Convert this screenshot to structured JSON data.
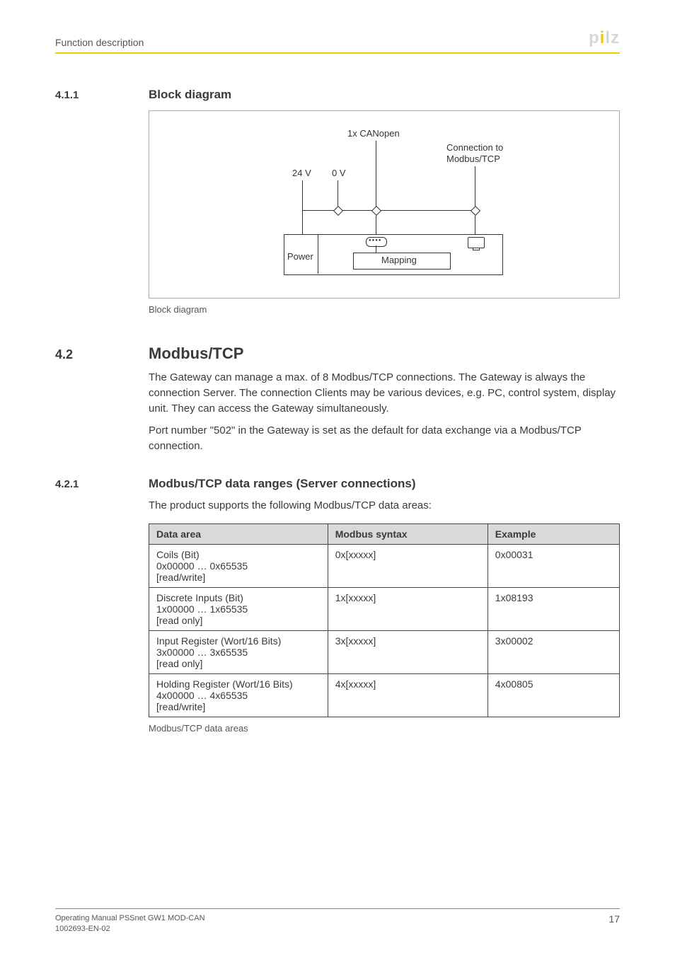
{
  "header": {
    "breadcrumb": "Function description",
    "logo_text": "pilz"
  },
  "sections": {
    "s411": {
      "num": "4.1.1",
      "title": "Block diagram"
    },
    "s42": {
      "num": "4.2",
      "title": "Modbus/TCP"
    },
    "s421": {
      "num": "4.2.1",
      "title": "Modbus/TCP data ranges (Server connections)"
    }
  },
  "figure": {
    "label_can": "1x CANopen",
    "label_conn1": "Connection to",
    "label_conn2": "Modbus/TCP",
    "label_24v": "24 V",
    "label_0v": "0 V",
    "label_power": "Power",
    "label_mapping": "Mapping",
    "caption": "Block diagram"
  },
  "modbus_tcp": {
    "p1": "The Gateway can manage a max. of 8 Modbus/TCP connections. The Gateway is always the connection Server. The connection Clients may be various devices, e.g. PC, control system, display unit. They can access the Gateway simultaneously.",
    "p2": "Port number \"502\" in the Gateway is set as the default for data exchange via a Modbus/TCP connection."
  },
  "data_ranges": {
    "intro": "The product supports the following Modbus/TCP data areas:",
    "headers": {
      "c1": "Data area",
      "c2": "Modbus syntax",
      "c3": "Example"
    },
    "rows": [
      {
        "area_l1": "Coils (Bit)",
        "area_l2": "0x00000 … 0x65535",
        "area_l3": "[read/write]",
        "syntax": "0x[xxxxx]",
        "example": "0x00031"
      },
      {
        "area_l1": "Discrete Inputs (Bit)",
        "area_l2": "1x00000 … 1x65535",
        "area_l3": "[read only]",
        "syntax": "1x[xxxxx]",
        "example": "1x08193"
      },
      {
        "area_l1": "Input Register (Wort/16 Bits)",
        "area_l2": "3x00000 … 3x65535",
        "area_l3": "[read only]",
        "syntax": "3x[xxxxx]",
        "example": "3x00002"
      },
      {
        "area_l1": "Holding Register (Wort/16 Bits)",
        "area_l2": "4x00000 … 4x65535",
        "area_l3": "[read/write]",
        "syntax": "4x[xxxxx]",
        "example": "4x00805"
      }
    ],
    "caption": "Modbus/TCP data areas"
  },
  "footer": {
    "line1": "Operating Manual PSSnet GW1 MOD-CAN",
    "line2": "1002693-EN-02",
    "page": "17"
  }
}
